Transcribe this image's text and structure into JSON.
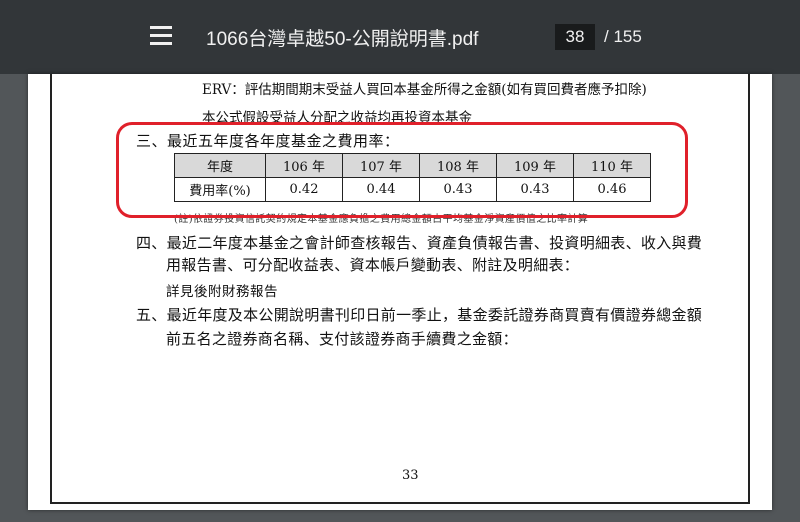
{
  "toolbar": {
    "menu_icon": "hamburger-menu-icon",
    "title": "1066台灣卓越50-公開說明書.pdf",
    "current_page": "38",
    "total_pages": "/ 155"
  },
  "document": {
    "line_erv": "ERV：評估期間期末受益人買回本基金所得之金額(如有買回費者應予扣除)",
    "line_assumption": "本公式假設受益人分配之收益均再投資本基金",
    "section3_heading": "三、最近五年度各年度基金之費用率：",
    "fee_table": {
      "header": [
        "年度",
        "106 年",
        "107 年",
        "108 年",
        "109 年",
        "110 年"
      ],
      "row": [
        "費用率(%)",
        "0.42",
        "0.44",
        "0.43",
        "0.43",
        "0.46"
      ]
    },
    "note": "(註)依證券投資信託契約規定本基金應負擔之費用總金額占平均基金淨資產價值之比率計算",
    "section4_line1": "四、最近二年度本基金之會計師查核報告、資產負債報告書、投資明細表、收入與費",
    "section4_line2": "用報告書、可分配收益表、資本帳戶變動表、附註及明細表：",
    "section4_detail": "詳見後附財務報告",
    "section5_line1": "五、最近年度及本公開說明書刊印日前一季止，基金委託證券商買賣有價證券總金額",
    "section5_line2": "前五名之證券商名稱、支付該證券商手續費之金額：",
    "page_number": "33"
  },
  "colors": {
    "toolbar_bg": "#323639",
    "viewer_bg": "#525659",
    "annotation": "#e0202a",
    "table_header_bg": "#d9d9d9"
  }
}
